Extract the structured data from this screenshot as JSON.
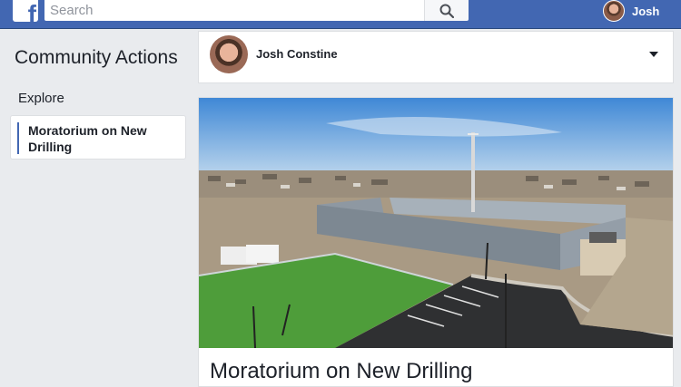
{
  "topbar": {
    "logo_letter": "f",
    "search_placeholder": "Search",
    "profile_name": "Josh"
  },
  "sidebar": {
    "title": "Community Actions",
    "explore_label": "Explore",
    "items": [
      {
        "label": "Moratorium on New Drilling",
        "selected": true
      }
    ]
  },
  "main": {
    "author": {
      "name": "Josh Constine"
    },
    "post": {
      "title": "Moratorium on New Drilling",
      "image_subject": "aerial view of a drilling site beside a sports field and housing development"
    }
  },
  "colors": {
    "brand_blue": "#4267b2",
    "background": "#e9ebee",
    "card": "#ffffff",
    "text": "#1d2129"
  },
  "icons": [
    "facebook-logo-icon",
    "search-icon",
    "chevron-down-icon"
  ]
}
